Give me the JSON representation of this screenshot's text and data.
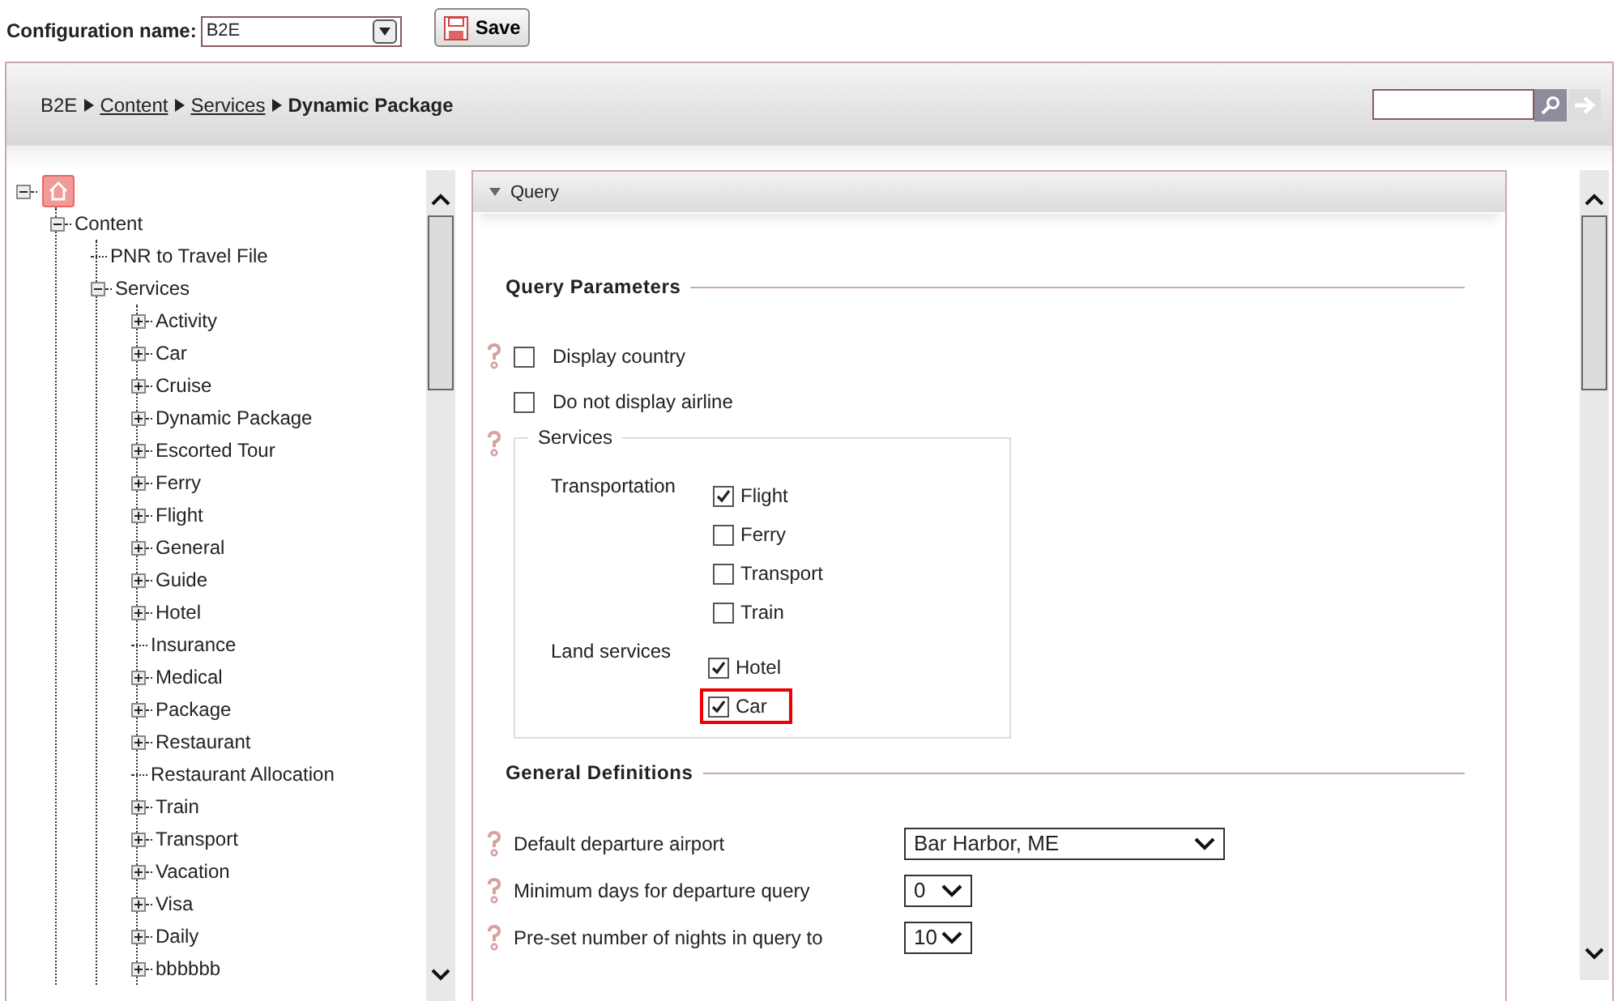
{
  "config": {
    "label": "Configuration name:",
    "value": "B2E",
    "save": "Save"
  },
  "breadcrumb": {
    "items": [
      {
        "text": "B2E",
        "kind": "plain"
      },
      {
        "text": "Content",
        "kind": "link"
      },
      {
        "text": "Services",
        "kind": "link"
      },
      {
        "text": "Dynamic Package",
        "kind": "current"
      }
    ]
  },
  "tree": [
    {
      "kind": "home",
      "expanded": true,
      "children": [
        {
          "label": "Content",
          "kind": "node",
          "expanded": true,
          "children": [
            {
              "label": "PNR to Travel File",
              "kind": "leaf"
            },
            {
              "label": "Services",
              "kind": "node",
              "expanded": true,
              "children": [
                {
                  "label": "Activity",
                  "kind": "node",
                  "expanded": false
                },
                {
                  "label": "Car",
                  "kind": "node",
                  "expanded": false
                },
                {
                  "label": "Cruise",
                  "kind": "node",
                  "expanded": false
                },
                {
                  "label": "Dynamic Package",
                  "kind": "node",
                  "expanded": false
                },
                {
                  "label": "Escorted Tour",
                  "kind": "node",
                  "expanded": false
                },
                {
                  "label": "Ferry",
                  "kind": "node",
                  "expanded": false
                },
                {
                  "label": "Flight",
                  "kind": "node",
                  "expanded": false
                },
                {
                  "label": "General",
                  "kind": "node",
                  "expanded": false
                },
                {
                  "label": "Guide",
                  "kind": "node",
                  "expanded": false
                },
                {
                  "label": "Hotel",
                  "kind": "node",
                  "expanded": false
                },
                {
                  "label": "Insurance",
                  "kind": "leaf"
                },
                {
                  "label": "Medical",
                  "kind": "node",
                  "expanded": false
                },
                {
                  "label": "Package",
                  "kind": "node",
                  "expanded": false
                },
                {
                  "label": "Restaurant",
                  "kind": "node",
                  "expanded": false
                },
                {
                  "label": "Restaurant Allocation",
                  "kind": "leaf"
                },
                {
                  "label": "Train",
                  "kind": "node",
                  "expanded": false
                },
                {
                  "label": "Transport",
                  "kind": "node",
                  "expanded": false
                },
                {
                  "label": "Vacation",
                  "kind": "node",
                  "expanded": false
                },
                {
                  "label": "Visa",
                  "kind": "node",
                  "expanded": false
                },
                {
                  "label": "Daily",
                  "kind": "node",
                  "expanded": false
                },
                {
                  "label": "bbbbbb",
                  "kind": "node",
                  "expanded": false
                }
              ]
            }
          ]
        }
      ]
    }
  ],
  "panel": {
    "title": "Query",
    "expanded": true,
    "sections": [
      {
        "title": "Query Parameters",
        "items": [
          {
            "kind": "checkbox",
            "help": true,
            "label": "Display country",
            "checked": false
          },
          {
            "kind": "checkbox",
            "help": false,
            "label": "Do not display airline",
            "checked": false
          },
          {
            "kind": "services",
            "help": true,
            "legend": "Services",
            "groups": [
              {
                "label": "Transportation",
                "options": [
                  {
                    "label": "Flight",
                    "checked": true,
                    "highlighted": false
                  },
                  {
                    "label": "Ferry",
                    "checked": false,
                    "highlighted": false
                  },
                  {
                    "label": "Transport",
                    "checked": false,
                    "highlighted": false
                  },
                  {
                    "label": "Train",
                    "checked": false,
                    "highlighted": false
                  }
                ]
              },
              {
                "label": "Land services",
                "options": [
                  {
                    "label": "Hotel",
                    "checked": true,
                    "highlighted": false
                  },
                  {
                    "label": "Car",
                    "checked": true,
                    "highlighted": true
                  }
                ]
              }
            ]
          }
        ]
      },
      {
        "title": "General Definitions",
        "items": [
          {
            "kind": "select",
            "help": true,
            "label": "Default departure airport",
            "value": "Bar Harbor, ME"
          },
          {
            "kind": "select",
            "help": true,
            "label": "Minimum days for departure query",
            "value": "0"
          },
          {
            "kind": "select",
            "help": true,
            "label": "Pre-set number of nights in query to",
            "value": "10"
          }
        ]
      }
    ]
  }
}
